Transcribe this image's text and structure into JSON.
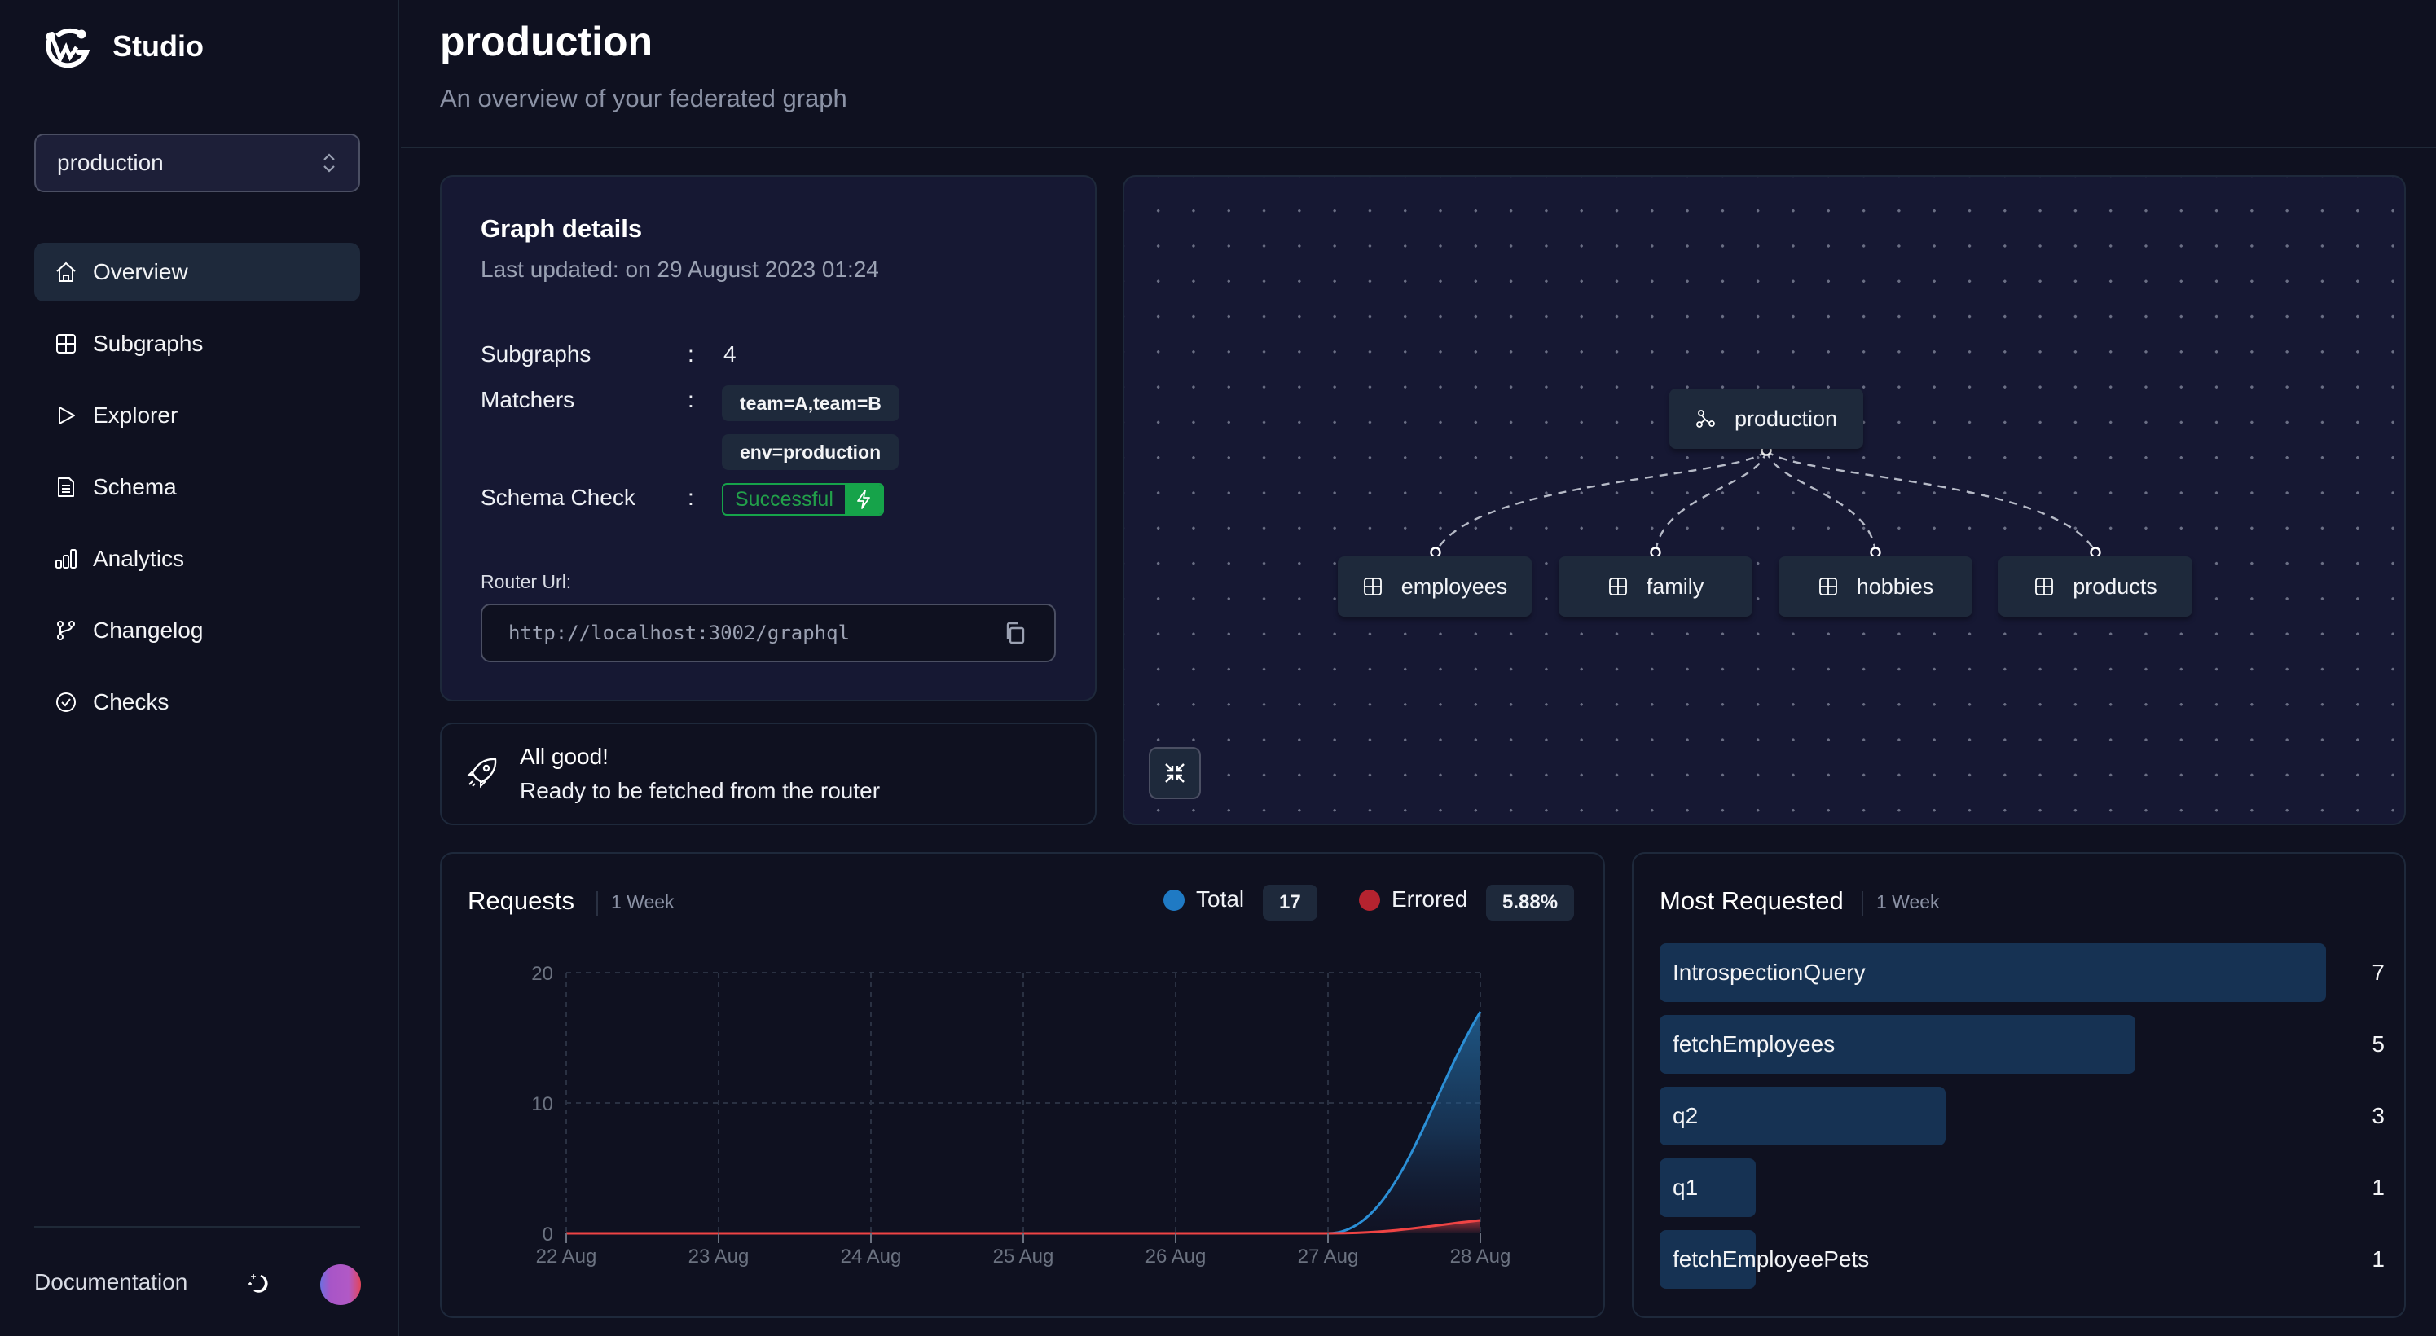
{
  "app": {
    "name": "Studio"
  },
  "sidebar": {
    "graph_selector": {
      "value": "production"
    },
    "items": [
      {
        "label": "Overview",
        "icon": "home-icon",
        "active": true
      },
      {
        "label": "Subgraphs",
        "icon": "grid-icon",
        "active": false
      },
      {
        "label": "Explorer",
        "icon": "play-icon",
        "active": false
      },
      {
        "label": "Schema",
        "icon": "document-icon",
        "active": false
      },
      {
        "label": "Analytics",
        "icon": "bar-chart-icon",
        "active": false
      },
      {
        "label": "Changelog",
        "icon": "git-branch-icon",
        "active": false
      },
      {
        "label": "Checks",
        "icon": "check-circle-icon",
        "active": false
      }
    ],
    "footer": {
      "documentation": "Documentation",
      "theme_icon": "moon-stars-icon"
    }
  },
  "header": {
    "title": "production",
    "subtitle": "An overview of your federated graph"
  },
  "graph_details": {
    "title": "Graph details",
    "last_updated": "Last updated: on 29 August 2023 01:24",
    "subgraphs_label": "Subgraphs",
    "subgraphs_value": "4",
    "matchers_label": "Matchers",
    "matchers": [
      "team=A,team=B",
      "env=production"
    ],
    "schema_check_label": "Schema Check",
    "schema_check_status": "Successful",
    "colon": ":",
    "router_url_label": "Router Url:",
    "router_url": "http://localhost:3002/graphql"
  },
  "status": {
    "title": "All good!",
    "description": "Ready to be fetched from the router"
  },
  "graph_canvas": {
    "root": {
      "label": "production",
      "icon": "federated-graph-icon"
    },
    "subgraphs": [
      {
        "label": "employees",
        "icon": "grid-icon"
      },
      {
        "label": "family",
        "icon": "grid-icon"
      },
      {
        "label": "hobbies",
        "icon": "grid-icon"
      },
      {
        "label": "products",
        "icon": "grid-icon"
      }
    ]
  },
  "requests": {
    "title": "Requests",
    "range": "1 Week",
    "legend": [
      {
        "label": "Total",
        "value": "17",
        "color": "#1f7ac4"
      },
      {
        "label": "Errored",
        "value": "5.88%",
        "color": "#b4232f"
      }
    ]
  },
  "most_requested": {
    "title": "Most Requested",
    "range": "1 Week",
    "operations": [
      {
        "name": "IntrospectionQuery",
        "count": 7
      },
      {
        "name": "fetchEmployees",
        "count": 5
      },
      {
        "name": "q2",
        "count": 3
      },
      {
        "name": "q1",
        "count": 1
      },
      {
        "name": "fetchEmployeePets",
        "count": 1
      }
    ]
  },
  "chart_data": {
    "type": "area",
    "title": "Requests",
    "x": [
      "22 Aug",
      "23 Aug",
      "24 Aug",
      "25 Aug",
      "26 Aug",
      "27 Aug",
      "28 Aug"
    ],
    "series": [
      {
        "name": "Total",
        "values": [
          0,
          0,
          0,
          0,
          0,
          0,
          17
        ],
        "color": "#2b8fd6"
      },
      {
        "name": "Errored",
        "values": [
          0,
          0,
          0,
          0,
          0,
          0,
          1
        ],
        "color": "#ef4444"
      }
    ],
    "y_ticks": [
      "0",
      "10",
      "20"
    ],
    "ylim": [
      0,
      20
    ],
    "xlabel": "",
    "ylabel": "",
    "grid": true,
    "legend": "top-right"
  }
}
